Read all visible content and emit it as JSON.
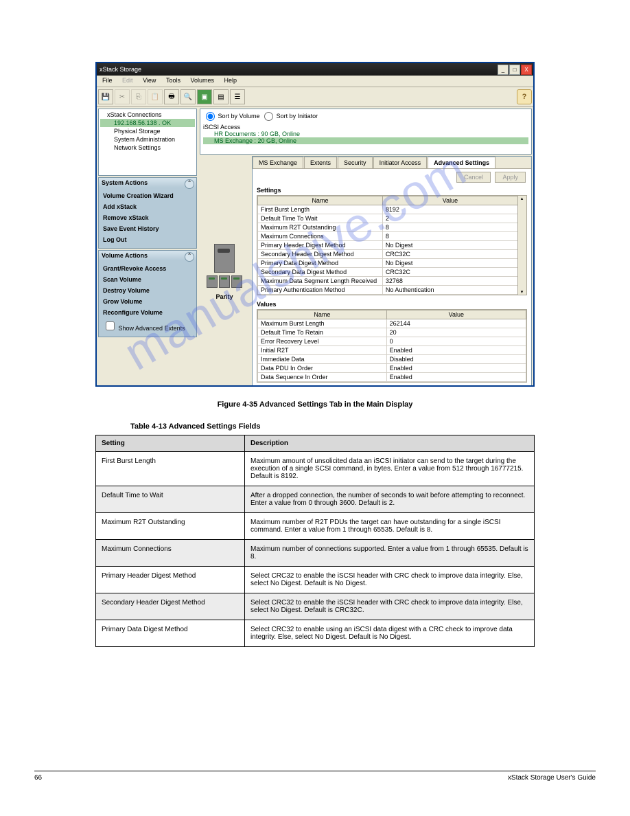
{
  "window": {
    "title": "xStack Storage",
    "min": "_",
    "max": "□",
    "close": "X"
  },
  "menu": {
    "file": "File",
    "edit": "Edit",
    "view": "View",
    "tools": "Tools",
    "volumes": "Volumes",
    "help": "Help"
  },
  "tree": {
    "root": "xStack Connections",
    "ip": "192.168.56.138 . OK",
    "items": [
      "Physical Storage",
      "System Administration",
      "Network Settings"
    ]
  },
  "system_actions": {
    "title": "System Actions",
    "items": [
      "Volume Creation Wizard",
      "Add xStack",
      "Remove xStack",
      "Save Event History",
      "Log Out"
    ]
  },
  "volume_actions": {
    "title": "Volume Actions",
    "items": [
      "Grant/Revoke Access",
      "Scan Volume",
      "Destroy Volume",
      "Grow Volume",
      "Reconfigure Volume"
    ],
    "checkbox": "Show Advanced Extents"
  },
  "sort": {
    "by_volume": "Sort by Volume",
    "by_initiator": "Sort by Initiator"
  },
  "iscsi": {
    "root": "iSCSI Access",
    "vols": [
      "HR Documents : 90 GB, Online",
      "MS Exchange : 20 GB, Online"
    ]
  },
  "vol_stack_label": "Parity",
  "tabs": [
    "MS Exchange",
    "Extents",
    "Security",
    "Initiator Access",
    "Advanced Settings"
  ],
  "buttons": {
    "cancel": "Cancel",
    "apply": "Apply"
  },
  "settings_hdr": "Settings",
  "values_hdr": "Values",
  "grid_headers": {
    "name": "Name",
    "value": "Value"
  },
  "settings_rows": [
    {
      "name": "First Burst Length",
      "value": "8192"
    },
    {
      "name": "Default Time To Wait",
      "value": "2"
    },
    {
      "name": "Maximum R2T Outstanding",
      "value": "8"
    },
    {
      "name": "Maximum Connections",
      "value": "8"
    },
    {
      "name": "Primary Header Digest Method",
      "value": "No Digest"
    },
    {
      "name": "Secondary Header Digest Method",
      "value": "CRC32C"
    },
    {
      "name": "Primary Data Digest Method",
      "value": "No Digest"
    },
    {
      "name": "Secondary Data Digest Method",
      "value": "CRC32C"
    },
    {
      "name": "Maximum Data Segment Length Received",
      "value": "32768"
    },
    {
      "name": "Primary Authentication Method",
      "value": "No Authentication"
    }
  ],
  "values_rows": [
    {
      "name": "Maximum Burst Length",
      "value": "262144"
    },
    {
      "name": "Default Time To Retain",
      "value": "20"
    },
    {
      "name": "Error Recovery Level",
      "value": "0"
    },
    {
      "name": "Initial R2T",
      "value": "Enabled"
    },
    {
      "name": "Immediate Data",
      "value": "Disabled"
    },
    {
      "name": "Data PDU In Order",
      "value": "Enabled"
    },
    {
      "name": "Data Sequence In Order",
      "value": "Enabled"
    }
  ],
  "figure_caption": "Figure 4-35 Advanced Settings Tab in the Main Display",
  "table_caption": "Table 4-13 Advanced Settings Fields",
  "fields_table": {
    "headers": [
      "Setting",
      "Description"
    ],
    "rows": [
      [
        "First Burst Length",
        "Maximum amount of unsolicited data an iSCSI initiator can send to the target during the execution of a single SCSI command, in bytes. Enter a value from 512 through 16777215. Default is 8192."
      ],
      [
        "Default Time to Wait",
        "After a dropped connection, the number of seconds to wait before attempting to reconnect. Enter a value from 0 through 3600. Default is 2."
      ],
      [
        "Maximum R2T Outstanding",
        "Maximum number of R2T PDUs the target can have outstanding for a single iSCSI command. Enter a value from 1 through 65535. Default is 8."
      ],
      [
        "Maximum Connections",
        "Maximum number of connections supported. Enter a value from 1 through 65535. Default is 8."
      ],
      [
        "Primary Header Digest Method",
        "Select CRC32 to enable the iSCSI header with CRC check to improve data integrity. Else, select No Digest. Default is No Digest."
      ],
      [
        "Secondary Header Digest Method",
        "Select CRC32 to enable the iSCSI header with CRC check to improve data integrity. Else, select No Digest. Default is CRC32C."
      ],
      [
        "Primary Data Digest Method",
        "Select CRC32 to enable using an iSCSI data digest with a CRC check to improve data integrity. Else, select No Digest. Default is No Digest."
      ]
    ]
  },
  "watermark": "manualshive.com",
  "footer": {
    "page": "66",
    "doc": "xStack Storage User's Guide"
  }
}
